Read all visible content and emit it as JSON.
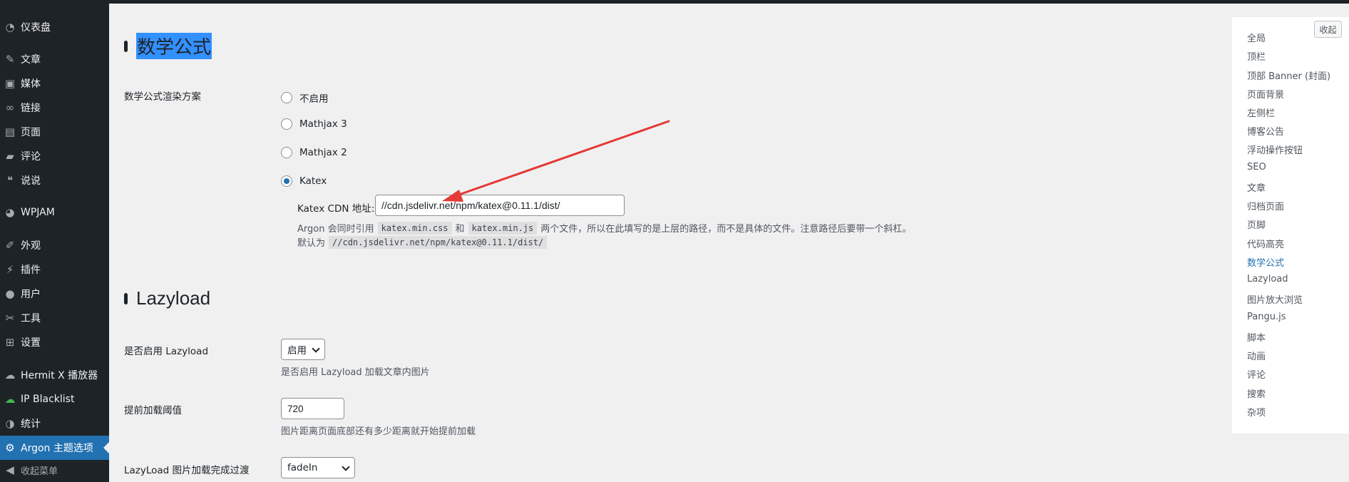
{
  "sidebar": {
    "items": [
      {
        "icon": "dashboard-icon",
        "glyph": "◔",
        "label": "仪表盘"
      },
      {
        "icon": "pin-icon",
        "glyph": "✎",
        "label": "文章"
      },
      {
        "icon": "media-icon",
        "glyph": "▣",
        "label": "媒体"
      },
      {
        "icon": "link-icon",
        "glyph": "∞",
        "label": "链接"
      },
      {
        "icon": "page-icon",
        "glyph": "▤",
        "label": "页面"
      },
      {
        "icon": "comment-icon",
        "glyph": "▰",
        "label": "评论"
      },
      {
        "icon": "quote-icon",
        "glyph": "❝",
        "label": "说说"
      },
      {
        "icon": "wpjam-icon",
        "glyph": "◕",
        "label": "WPJAM"
      },
      {
        "icon": "appearance-icon",
        "glyph": "✐",
        "label": "外观"
      },
      {
        "icon": "plugin-icon",
        "glyph": "⚡",
        "label": "插件"
      },
      {
        "icon": "user-icon",
        "glyph": "●",
        "label": "用户"
      },
      {
        "icon": "tools-icon",
        "glyph": "✂",
        "label": "工具"
      },
      {
        "icon": "settings-icon",
        "glyph": "⊞",
        "label": "设置"
      },
      {
        "icon": "cloud-icon",
        "glyph": "☁",
        "label": "Hermit X 播放器"
      },
      {
        "icon": "cloud-green-icon",
        "glyph": "☁",
        "label": "IP Blacklist"
      },
      {
        "icon": "stats-icon",
        "glyph": "◑",
        "label": "统计"
      },
      {
        "icon": "gear-icon",
        "glyph": "⚙",
        "label": "Argon 主题选项"
      },
      {
        "icon": "collapse-menu-icon",
        "glyph": "◀",
        "label": "收起菜单"
      }
    ]
  },
  "math": {
    "heading": "数学公式",
    "field_label": "数学公式渲染方案",
    "options": [
      "不启用",
      "Mathjax 3",
      "Mathjax 2",
      "Katex"
    ],
    "selected": "Katex",
    "cdn_label": "Katex CDN 地址:",
    "cdn_value": "//cdn.jsdelivr.net/npm/katex@0.11.1/dist/",
    "desc1_a": "Argon 会同时引用",
    "desc1_code1": "katex.min.css",
    "desc1_b": "和",
    "desc1_code2": "katex.min.js",
    "desc1_c": "两个文件，所以在此填写的是上层的路径，而不是具体的文件。注意路径后要带一个斜杠。",
    "desc2_a": "默认为",
    "desc2_code": "//cdn.jsdelivr.net/npm/katex@0.11.1/dist/"
  },
  "lazyload": {
    "heading": "Lazyload",
    "enable_label": "是否启用 Lazyload",
    "enable_value": "启用",
    "enable_desc": "是否启用 Lazyload 加载文章内图片",
    "threshold_label": "提前加载阈值",
    "threshold_value": "720",
    "threshold_desc": "图片距离页面底部还有多少距离就开始提前加载",
    "transition_label": "LazyLoad 图片加载完成过渡",
    "transition_value": "fadeIn"
  },
  "rnav": {
    "collapse_label": "收起",
    "items": [
      "全局",
      "顶栏",
      "顶部 Banner (封面)",
      "页面背景",
      "左侧栏",
      "博客公告",
      "浮动操作按钮",
      "SEO",
      "文章",
      "归档页面",
      "页脚",
      "代码高亮",
      "数学公式",
      "Lazyload",
      "图片放大浏览",
      "Pangu.js",
      "脚本",
      "动画",
      "评论",
      "搜索",
      "杂项"
    ],
    "current": "数学公式"
  },
  "colors": {
    "accent": "#2271b1",
    "sidebar_bg": "#1d2327",
    "arrow": "#e53935"
  }
}
